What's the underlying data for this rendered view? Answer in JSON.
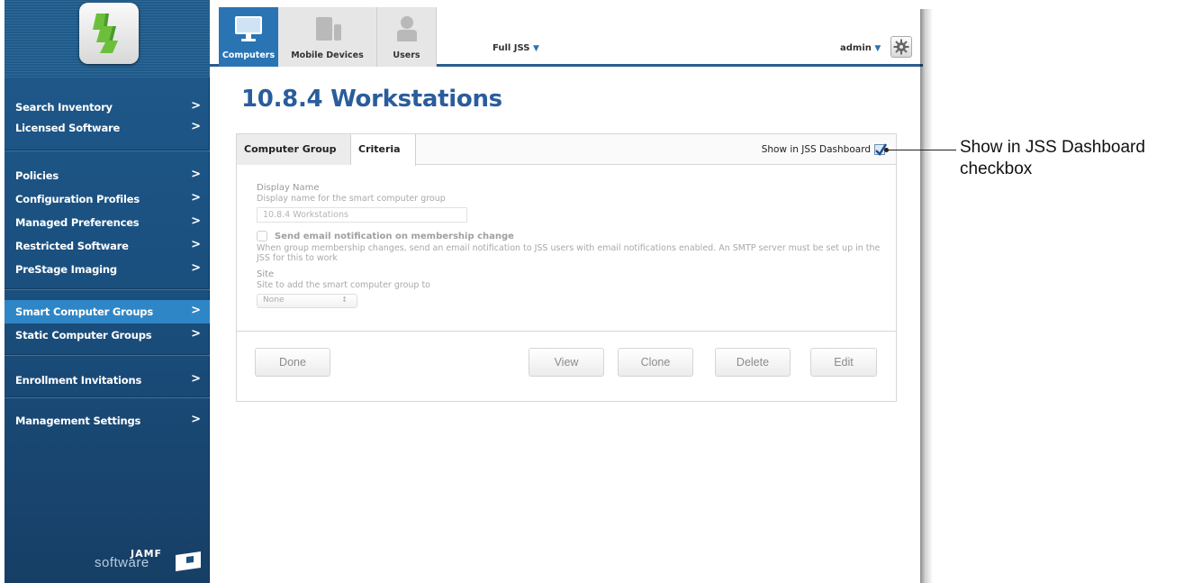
{
  "topnav": {
    "tabs": [
      {
        "label": "Computers",
        "icon": "monitor-icon",
        "active": true
      },
      {
        "label": "Mobile Devices",
        "icon": "mobile-devices-icon",
        "active": false
      },
      {
        "label": "Users",
        "icon": "user-icon",
        "active": false
      }
    ],
    "jss_select": "Full JSS",
    "user": "admin"
  },
  "sidebar": {
    "groups": [
      [
        "Search Inventory",
        "Licensed Software"
      ],
      [
        "Policies",
        "Configuration Profiles",
        "Managed Preferences",
        "Restricted Software",
        "PreStage Imaging"
      ],
      [
        "Smart Computer Groups",
        "Static Computer Groups"
      ],
      [
        "Enrollment Invitations"
      ],
      [
        "Management Settings"
      ]
    ],
    "active_item": "Smart Computer Groups",
    "brand_top": "JAMF",
    "brand_bottom": "software"
  },
  "page": {
    "title": "10.8.4 Workstations",
    "tabs": [
      "Computer Group",
      "Criteria"
    ],
    "dashboard_label": "Show in JSS Dashboard",
    "dashboard_checked": true,
    "form": {
      "display_name_label": "Display Name",
      "display_name_help": "Display name for the smart computer group",
      "display_name_value": "10.8.4 Workstations",
      "email_label": "Send email notification on membership change",
      "email_desc": "When group membership changes, send an email notification to JSS users with email notifications enabled. An SMTP server must be set up in the JSS for this to work",
      "site_label": "Site",
      "site_help": "Site to add the smart computer group to",
      "site_value": "None"
    },
    "buttons": {
      "done": "Done",
      "view": "View",
      "clone": "Clone",
      "delete": "Delete",
      "edit": "Edit"
    }
  },
  "annotation": {
    "text_line1": "Show in JSS Dashboard",
    "text_line2": "checkbox"
  },
  "colors": {
    "sidebar": "#1b4f7e",
    "accent": "#2a74b4",
    "title": "#2a5d9c"
  }
}
